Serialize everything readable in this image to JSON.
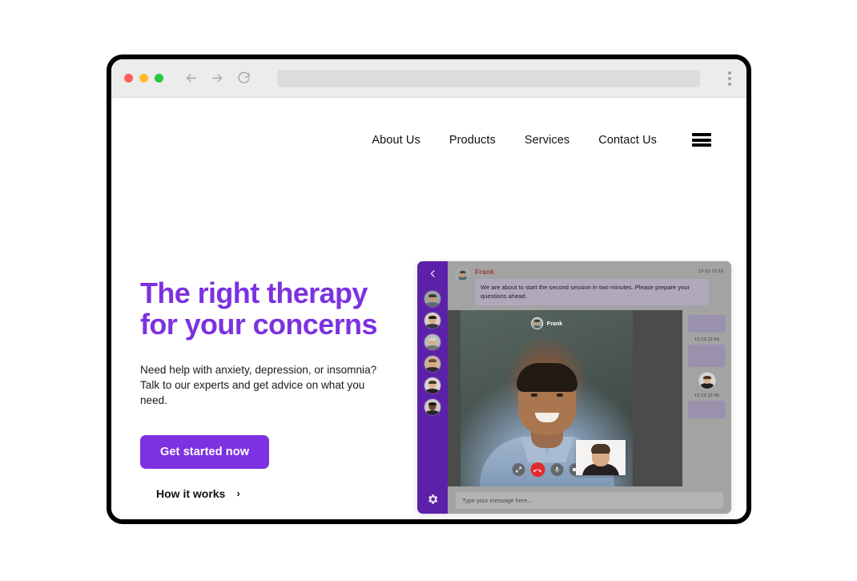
{
  "browser": {
    "traffic_lights": [
      "close",
      "minimize",
      "maximize"
    ],
    "back_icon": "arrow-left-icon",
    "forward_icon": "arrow-right-icon",
    "reload_icon": "reload-icon",
    "address_value": "",
    "menu_icon": "kebab-menu-icon",
    "colors": {
      "close": "#ff5f57",
      "minimize": "#febc2e",
      "maximize": "#28c840"
    }
  },
  "site": {
    "nav": {
      "links": [
        {
          "label": "About Us"
        },
        {
          "label": "Products"
        },
        {
          "label": "Services"
        },
        {
          "label": "Contact Us"
        }
      ],
      "menu_icon": "hamburger-icon"
    },
    "hero": {
      "title_line1": "The right therapy",
      "title_line2": "for your concerns",
      "subtitle": "Need help with anxiety, depression, or insomnia? Talk to our experts and get advice on what you need.",
      "cta_label": "Get started now",
      "secondary_label": "How it works",
      "secondary_chevron": "›",
      "accent_color": "#7c32e0"
    }
  },
  "app": {
    "sidebar": {
      "back_icon": "chevron-left-icon",
      "settings_icon": "gear-icon",
      "avatars": [
        {
          "name": "contact-1"
        },
        {
          "name": "contact-2"
        },
        {
          "name": "contact-3"
        },
        {
          "name": "contact-4"
        },
        {
          "name": "contact-5"
        },
        {
          "name": "contact-6"
        }
      ],
      "background": "#5b21a8"
    },
    "chat": {
      "header_message": {
        "sender": "Frank",
        "text": "We are about to start the second session in two minutes. Please prepare your questions ahead.",
        "time": "12-23 12:53"
      },
      "right_column": {
        "time_1": "12-23 12:54",
        "time_2": "12-23 12:56"
      },
      "input_placeholder": "Type your message here...",
      "input_value": ""
    },
    "video": {
      "participant_name": "Frank",
      "controls": [
        {
          "name": "expand-icon",
          "label": "Expand"
        },
        {
          "name": "end-call-icon",
          "label": "End call"
        },
        {
          "name": "microphone-icon",
          "label": "Mute"
        },
        {
          "name": "camera-icon",
          "label": "Camera"
        }
      ],
      "end_call_color": "#e02b2b",
      "self_view_label": "Self view"
    }
  }
}
